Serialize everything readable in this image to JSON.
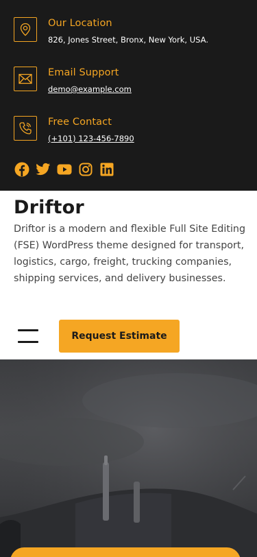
{
  "topbar": {
    "location": {
      "label": "Our Location",
      "value": "826, Jones Street, Bronx, New York, USA.",
      "icon": "map-pin-icon"
    },
    "email": {
      "label": "Email Support",
      "value": "demo@example.com",
      "icon": "envelope-icon"
    },
    "phone": {
      "label": "Free Contact",
      "value": "(+101) 123-456-7890",
      "icon": "phone-icon"
    },
    "socials": [
      "facebook-icon",
      "twitter-icon",
      "youtube-icon",
      "instagram-icon",
      "linkedin-icon"
    ]
  },
  "site": {
    "title": "Driftor",
    "description": "Driftor is a modern and flexible Full Site Editing (FSE) WordPress theme designed for transport, logistics, cargo, freight, trucking companies, shipping services, and delivery businesses."
  },
  "header": {
    "cta_label": "Request Estimate"
  },
  "colors": {
    "accent": "#f5a623",
    "dark": "#1a1a1a"
  }
}
